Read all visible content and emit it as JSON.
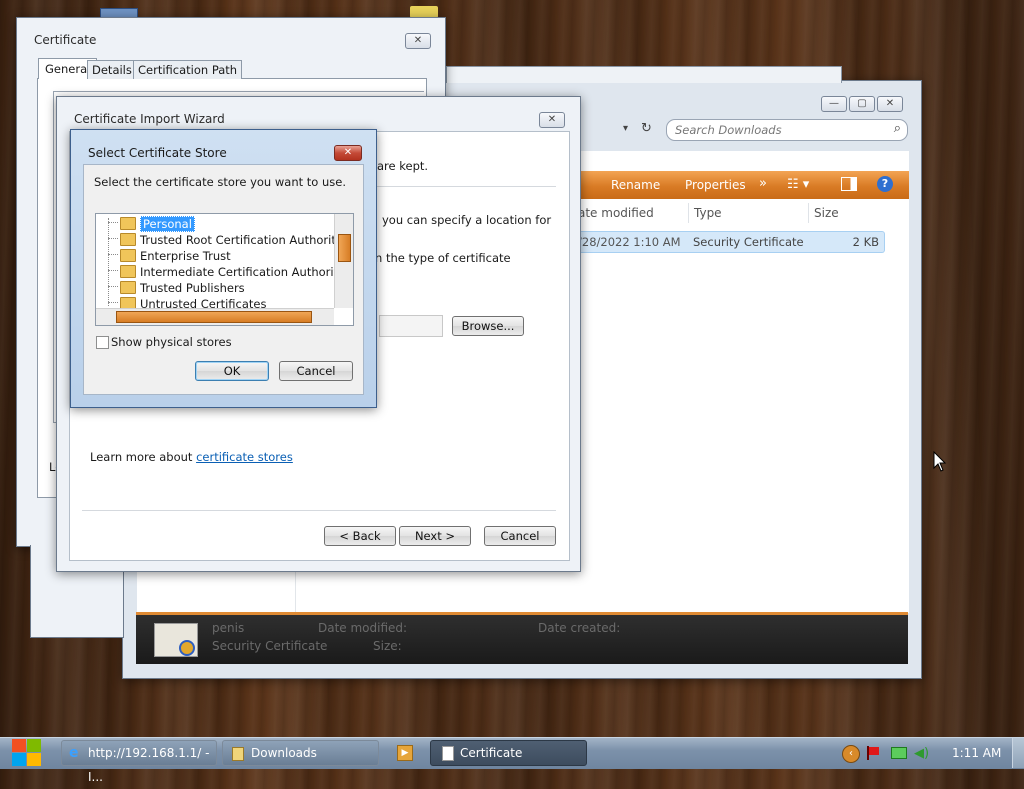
{
  "cert_window": {
    "title": "Certificate",
    "tabs": [
      "General",
      "Details",
      "Certification Path"
    ],
    "partial_left_text": "Le"
  },
  "explorer": {
    "search_placeholder": "Search Downloads",
    "toolbar": {
      "rename": "Rename",
      "properties": "Properties",
      "more": "»"
    },
    "columns": {
      "date": "ate modified",
      "type": "Type",
      "size": "Size"
    },
    "row": {
      "date": "/28/2022 1:10 AM",
      "type": "Security Certificate",
      "size": "2 KB"
    },
    "details": {
      "name": "penis",
      "kind": "Security Certificate",
      "date_modified_label": "Date modified:",
      "date_created_label": "Date created:",
      "size_label": "Size:"
    }
  },
  "wizard": {
    "title": "Certificate Import Wizard",
    "text1": "are kept.",
    "text2": "you can specify a location for",
    "text3": "n the type of certificate",
    "browse": "Browse...",
    "learn_more": "Learn more about ",
    "learn_link": "certificate stores",
    "back": "< Back",
    "next": "Next >",
    "cancel": "Cancel"
  },
  "store_dialog": {
    "title": "Select Certificate Store",
    "prompt": "Select the certificate store you want to use.",
    "stores": [
      "Personal",
      "Trusted Root Certification Authorities",
      "Enterprise Trust",
      "Intermediate Certification Authorities",
      "Trusted Publishers",
      "Untrusted Certificates"
    ],
    "selected_index": 0,
    "show_physical": "Show physical stores",
    "ok": "OK",
    "cancel": "Cancel"
  },
  "taskbar": {
    "items": [
      "http://192.168.1.1/ - I...",
      "Downloads",
      "Certificate"
    ],
    "active": "Certificate",
    "clock": "1:11 AM"
  },
  "colors": {
    "accent_orange": "#e0892f",
    "selection": "#3399ff",
    "taskbar": "#7e93ab"
  }
}
